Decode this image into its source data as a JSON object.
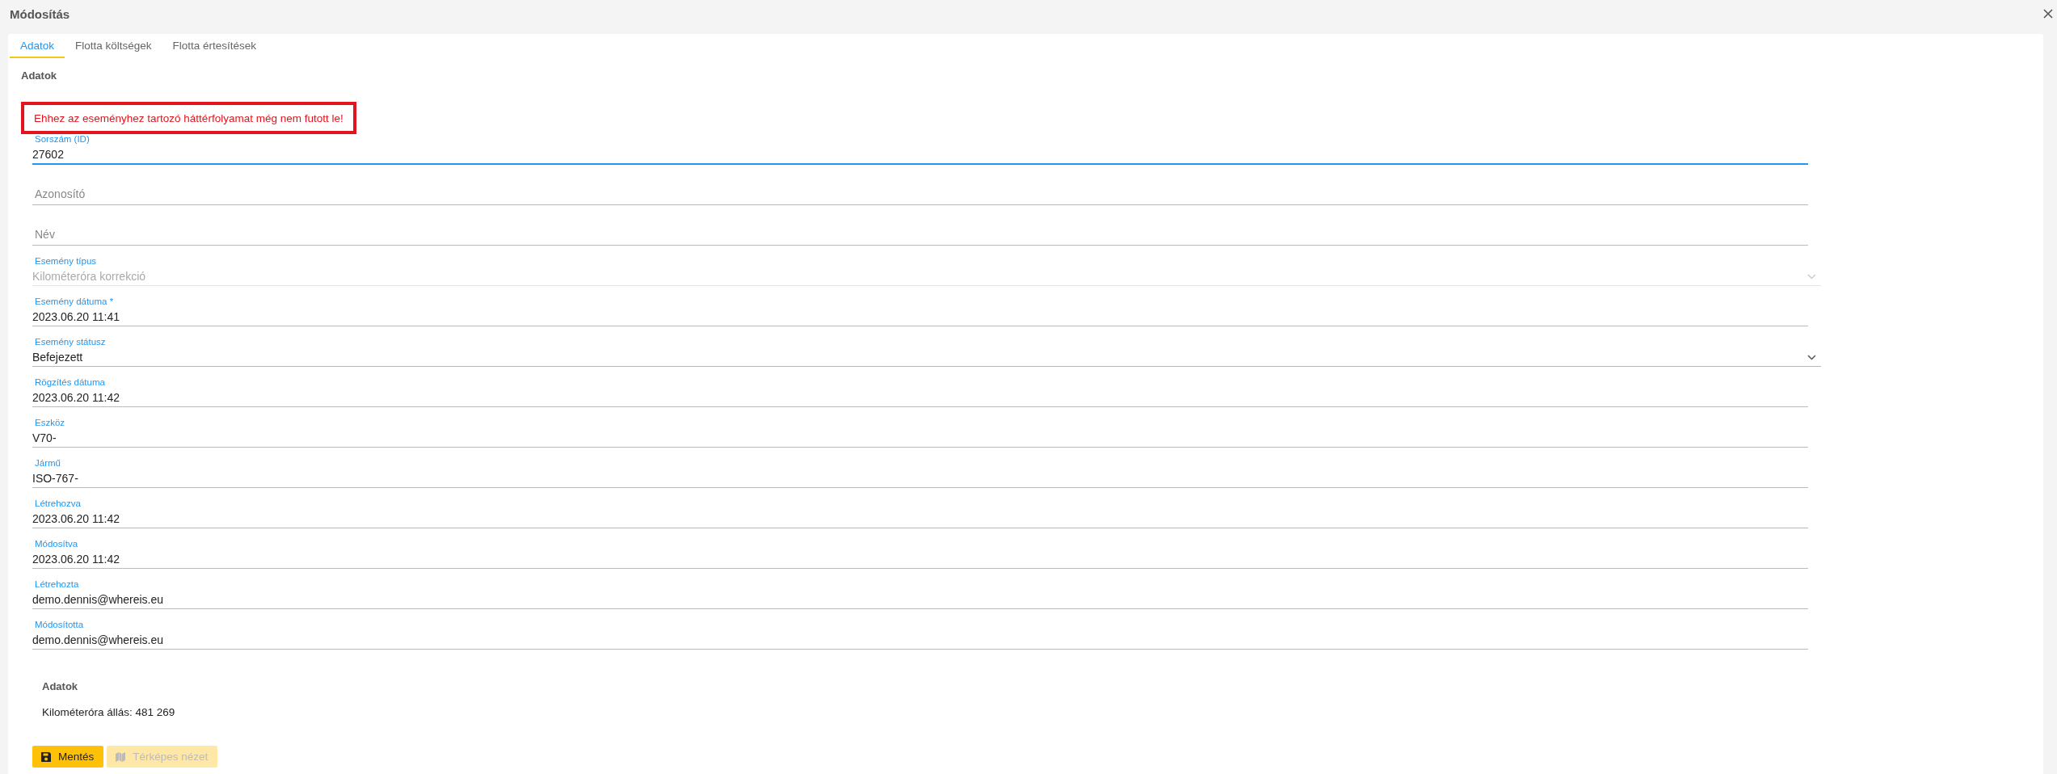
{
  "window": {
    "title": "Módosítás"
  },
  "tabs": [
    {
      "label": "Adatok",
      "selected": true
    },
    {
      "label": "Flotta költségek",
      "selected": false
    },
    {
      "label": "Flotta értesítések",
      "selected": false
    }
  ],
  "section_title": "Adatok",
  "alert": "Ehhez az eseményhez tartozó háttérfolyamat még nem futott le!",
  "fields": [
    {
      "kind": "text",
      "label": "Sorszám (ID)",
      "value": "27602",
      "focused": true,
      "disabled": false
    },
    {
      "kind": "text",
      "placeholder": "Azonosító",
      "focused": false,
      "disabled": false
    },
    {
      "kind": "text",
      "placeholder": "Név",
      "focused": false,
      "disabled": false
    },
    {
      "kind": "select",
      "label": "Esemény típus",
      "value": "Kilométeróra korrekció",
      "focused": false,
      "disabled": true
    },
    {
      "kind": "text",
      "label": "Esemény dátuma *",
      "value": "2023.06.20 11:41",
      "focused": false,
      "disabled": false
    },
    {
      "kind": "select",
      "label": "Esemény státusz",
      "value": "Befejezett",
      "focused": false,
      "disabled": false
    },
    {
      "kind": "text",
      "label": "Rögzítés dátuma",
      "value": "2023.06.20 11:42",
      "focused": false,
      "disabled": false
    },
    {
      "kind": "text",
      "label": "Eszköz",
      "value": "V70-",
      "focused": false,
      "disabled": false
    },
    {
      "kind": "text",
      "label": "Jármű",
      "value": "ISO-767-",
      "focused": false,
      "disabled": false
    },
    {
      "kind": "text",
      "label": "Létrehozva",
      "value": "2023.06.20 11:42",
      "focused": false,
      "disabled": false
    },
    {
      "kind": "text",
      "label": "Módosítva",
      "value": "2023.06.20 11:42",
      "focused": false,
      "disabled": false
    },
    {
      "kind": "text",
      "label": "Létrehozta",
      "value": "demo.dennis@whereis.eu",
      "focused": false,
      "disabled": false
    },
    {
      "kind": "text",
      "label": "Módosította",
      "value": "demo.dennis@whereis.eu",
      "focused": false,
      "disabled": false
    }
  ],
  "summary": {
    "title": "Adatok",
    "text": "Kilométeróra állás: 481 269"
  },
  "buttons": [
    {
      "kind": "save",
      "label": "Mentés",
      "disabled": false
    },
    {
      "kind": "map",
      "label": "Térképes nézet",
      "disabled": true
    }
  ]
}
